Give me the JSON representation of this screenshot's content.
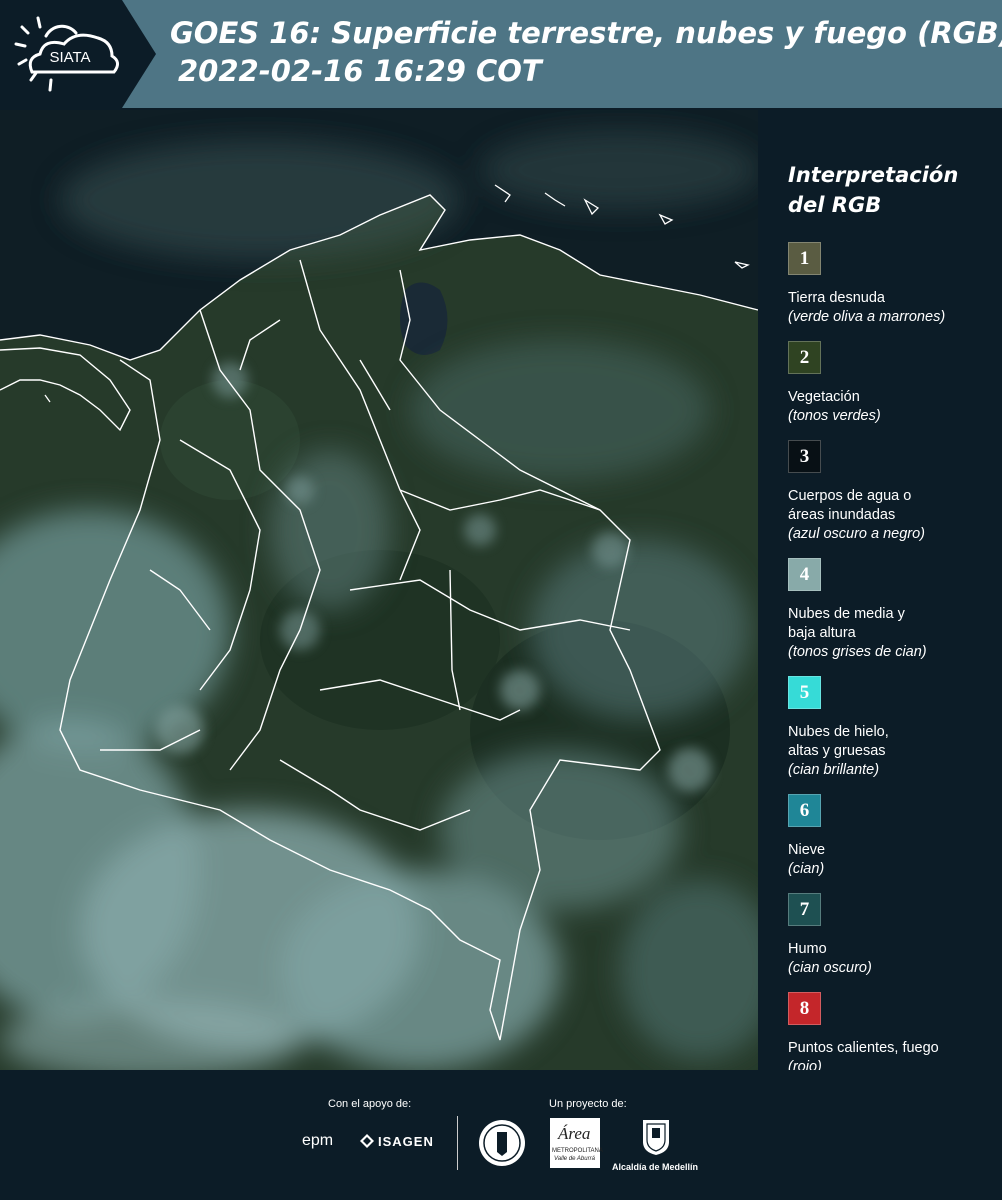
{
  "header": {
    "logo_text": "SIATA",
    "title_line1": "GOES 16: Superficie terrestre, nubes y fuego (RGB)",
    "title_line2": "2022-02-16 16:29 COT"
  },
  "legend": {
    "title_line1": "Interpretación",
    "title_line2": "del RGB",
    "items": [
      {
        "number": "1",
        "color": "#5a5c42",
        "label": "Tierra desnuda",
        "desc": "(verde oliva a marrones)"
      },
      {
        "number": "2",
        "color": "#2f4322",
        "label": "Vegetación",
        "desc": "(tonos verdes)"
      },
      {
        "number": "3",
        "color": "#081015",
        "label_lines": [
          "Cuerpos de agua o",
          "áreas inundadas"
        ],
        "desc": "(azul oscuro a negro)"
      },
      {
        "number": "4",
        "color": "#88aaa9",
        "label_lines": [
          "Nubes de media y",
          "baja altura"
        ],
        "desc": "(tonos grises de cian)"
      },
      {
        "number": "5",
        "color": "#36dbd7",
        "label_lines": [
          "Nubes de hielo,",
          "altas y gruesas"
        ],
        "desc": "(cian brillante)"
      },
      {
        "number": "6",
        "color": "#1f8697",
        "label": "Nieve",
        "desc": "(cian)"
      },
      {
        "number": "7",
        "color": "#1e5052",
        "label": "Humo",
        "desc": "(cian oscuro)"
      },
      {
        "number": "8",
        "color": "#c4262a",
        "label": "Puntos calientes, fuego",
        "desc": "(rojo)"
      }
    ]
  },
  "footer": {
    "support_caption": "Con el apoyo de:",
    "project_caption": "Un proyecto de:",
    "sponsor_epm": "epm",
    "sponsor_isagen": "ISAGEN",
    "area_text": "Área",
    "area_subtitle": "METROPOLITANA",
    "area_subtitle2": "Valle de Aburrá",
    "alcaldia": "Alcaldía de Medellín"
  }
}
